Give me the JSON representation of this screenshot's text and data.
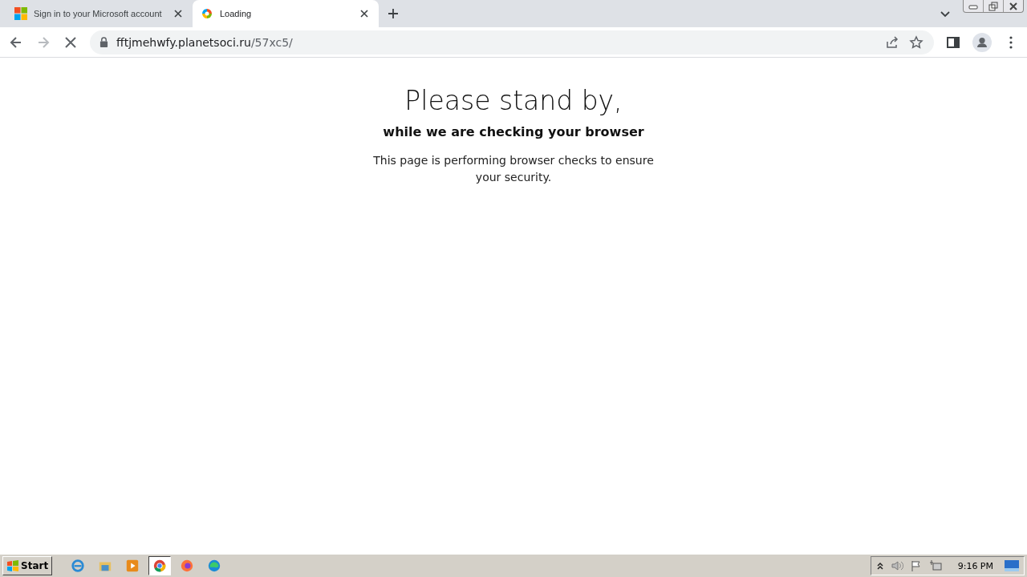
{
  "tabs": [
    {
      "title": "Sign in to your Microsoft account",
      "selected": false,
      "kind": "microsoft"
    },
    {
      "title": "Loading",
      "selected": true,
      "kind": "loading"
    }
  ],
  "address_bar": {
    "host": "fftjmehwfy.planetsoci.ru",
    "path": "/57xc5/"
  },
  "page": {
    "heading": "Please stand by,",
    "subheading": "while we are checking your browser",
    "message": "This page is performing browser checks to ensure your security."
  },
  "taskbar": {
    "start": "Start",
    "apps": [
      {
        "kind": "ie",
        "selected": false
      },
      {
        "kind": "explorer",
        "selected": false
      },
      {
        "kind": "media",
        "selected": false
      },
      {
        "kind": "chrome",
        "selected": true
      },
      {
        "kind": "firefox",
        "selected": false
      },
      {
        "kind": "edge",
        "selected": false
      }
    ],
    "clock": "9:16 PM"
  }
}
